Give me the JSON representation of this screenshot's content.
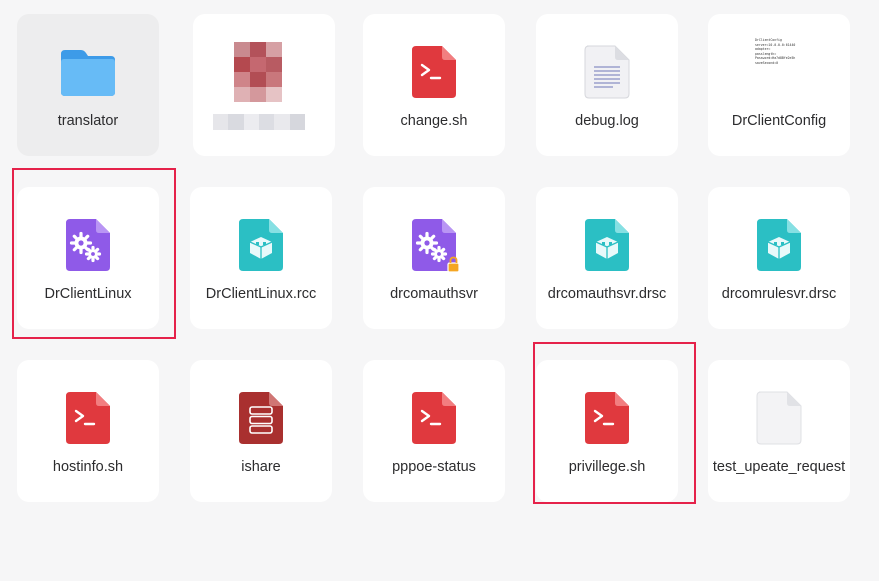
{
  "files": [
    {
      "name": "translator",
      "icon": "folder-icon"
    },
    {
      "name": "",
      "icon": "image-thumbnail-icon",
      "redacted": true
    },
    {
      "name": "change.sh",
      "icon": "shell-script-icon"
    },
    {
      "name": "debug.log",
      "icon": "text-document-icon"
    },
    {
      "name": "DrClientConfig",
      "icon": "config-document-icon"
    },
    {
      "name": "DrClientLinux",
      "icon": "executable-gear-icon"
    },
    {
      "name": "DrClientLinux.rcc",
      "icon": "package-icon"
    },
    {
      "name": "drcomauthsvr",
      "icon": "executable-gear-locked-icon"
    },
    {
      "name": "drcomauthsvr.drsc",
      "icon": "package-icon"
    },
    {
      "name": "drcomrulesvr.drsc",
      "icon": "package-icon"
    },
    {
      "name": "hostinfo.sh",
      "icon": "shell-script-icon"
    },
    {
      "name": "ishare",
      "icon": "database-icon"
    },
    {
      "name": "pppoe-status",
      "icon": "shell-script-icon"
    },
    {
      "name": "privillege.sh",
      "icon": "shell-script-icon"
    },
    {
      "name": "test_upeate_request",
      "icon": "blank-document-icon"
    }
  ],
  "config_preview_lines": [
    "DrClientConfig",
    "server=10.0.0.0:61440",
    "adapter=",
    "passlength=",
    "Password=Ha7d8Bfe2e5h",
    "saveSecond=0"
  ],
  "colors": {
    "highlight_border": "#e5224a",
    "shell": "#e0393e",
    "package": "#2bbfc4",
    "gear": "#8f5ae8",
    "folder": "#4eaaf2",
    "database": "#a9302f"
  }
}
